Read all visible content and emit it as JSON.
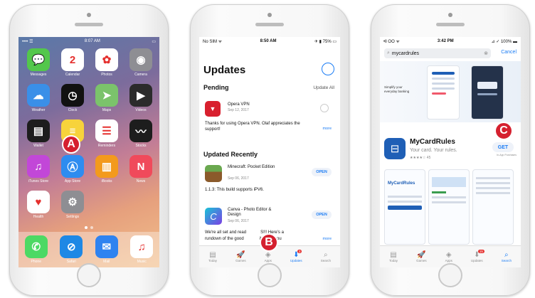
{
  "phone1": {
    "status": {
      "carrier": "•••• ☰",
      "time": "8:07 AM"
    },
    "apps": [
      {
        "label": "Messages",
        "icon": "messages-icon",
        "color": "#53c74c",
        "glyph": "💬"
      },
      {
        "label": "Calendar",
        "icon": "calendar-icon",
        "color": "#ffffff",
        "glyph": "2",
        "day": "Monday"
      },
      {
        "label": "Photos",
        "icon": "photos-icon",
        "color": "#ffffff",
        "glyph": "✿"
      },
      {
        "label": "Camera",
        "icon": "camera-icon",
        "color": "#8e8e93",
        "glyph": "◉"
      },
      {
        "label": "Weather",
        "icon": "weather-icon",
        "color": "#3a8fe8",
        "glyph": "☁"
      },
      {
        "label": "Clock",
        "icon": "clock-icon",
        "color": "#111111",
        "glyph": "◷"
      },
      {
        "label": "Maps",
        "icon": "maps-icon",
        "color": "#7bc36b",
        "glyph": "➤"
      },
      {
        "label": "Videos",
        "icon": "videos-icon",
        "color": "#2b2b2b",
        "glyph": "▶"
      },
      {
        "label": "Wallet",
        "icon": "wallet-icon",
        "color": "#1d1d1d",
        "glyph": "▤"
      },
      {
        "label": "Notes",
        "icon": "notes-icon",
        "color": "#f7d33b",
        "glyph": "≡"
      },
      {
        "label": "Reminders",
        "icon": "reminders-icon",
        "color": "#ffffff",
        "glyph": "☰"
      },
      {
        "label": "Stocks",
        "icon": "stocks-icon",
        "color": "#1d1d1d",
        "glyph": "〰"
      },
      {
        "label": "iTunes Store",
        "icon": "itunes-store-icon",
        "color": "#c247d8",
        "glyph": "♫"
      },
      {
        "label": "App Store",
        "icon": "app-store-icon",
        "color": "#2e8cf0",
        "glyph": "Ⓐ"
      },
      {
        "label": "iBooks",
        "icon": "ibooks-icon",
        "color": "#f39a1d",
        "glyph": "▥"
      },
      {
        "label": "News",
        "icon": "news-icon",
        "color": "#f04a5b",
        "glyph": "N"
      },
      {
        "label": "Health",
        "icon": "health-icon",
        "color": "#ffffff",
        "glyph": "♥"
      },
      {
        "label": "Settings",
        "icon": "settings-icon",
        "color": "#8e8e93",
        "glyph": "⚙"
      }
    ],
    "dock": [
      {
        "label": "Phone",
        "icon": "phone-icon",
        "color": "#4cd964",
        "glyph": "✆"
      },
      {
        "label": "Safari",
        "icon": "safari-icon",
        "color": "#1e88e5",
        "glyph": "⊘"
      },
      {
        "label": "Mail",
        "icon": "mail-icon",
        "color": "#2f83f0",
        "glyph": "✉"
      },
      {
        "label": "Music",
        "icon": "music-icon",
        "color": "#ffffff",
        "glyph": "♫"
      }
    ],
    "callout": "A"
  },
  "phone2": {
    "status": {
      "carrier": "No SIM ᯤ",
      "time": "8:50 AM",
      "battery": "✈ ▮ 75% ▭"
    },
    "title": "Updates",
    "pending": {
      "header": "Pending",
      "action": "Update All"
    },
    "opera": {
      "name": "Opera VPN",
      "date": "Sep 12, 2017",
      "note": "Thanks for using Opera VPN. Olaf appreciates the support!",
      "more": "more"
    },
    "recent_header": "Updated Recently",
    "minecraft": {
      "name": "Minecraft: Pocket Edition",
      "date": "Sep 06, 2017",
      "note": "1.1.3: This build supports iPV6.",
      "button": "OPEN"
    },
    "canva": {
      "name": "Canva - Photo Editor & Design",
      "date": "Sep 06, 2017",
      "note1": "We're all set and read",
      "note1b": "S!!! Here's a",
      "note2": "rundown of the good",
      "note2b": "iting for you",
      "more": "more",
      "button": "OPEN"
    },
    "tabs": [
      "Today",
      "Games",
      "Apps",
      "Updates",
      "Search"
    ],
    "updates_badge": "3",
    "callout": "B"
  },
  "phone3": {
    "status": {
      "carrier": "•ll OO ᯤ",
      "time": "3:42 PM",
      "battery": "⊿ ✓ 100% ▬"
    },
    "search": "mycardrules",
    "cancel": "Cancel",
    "promo": "Simplify your everyday banking",
    "app_name": "MyCardRules",
    "tagline": "Your card. Your rules.",
    "rating": "★★★★☆ 45",
    "get": "GET",
    "iap": "In-App Purchases",
    "screenshot_logo": "MyCardRules",
    "tabs": [
      "Today",
      "Games",
      "Apps",
      "Updates",
      "Search"
    ],
    "updates_badge": "15",
    "callout": "C"
  }
}
